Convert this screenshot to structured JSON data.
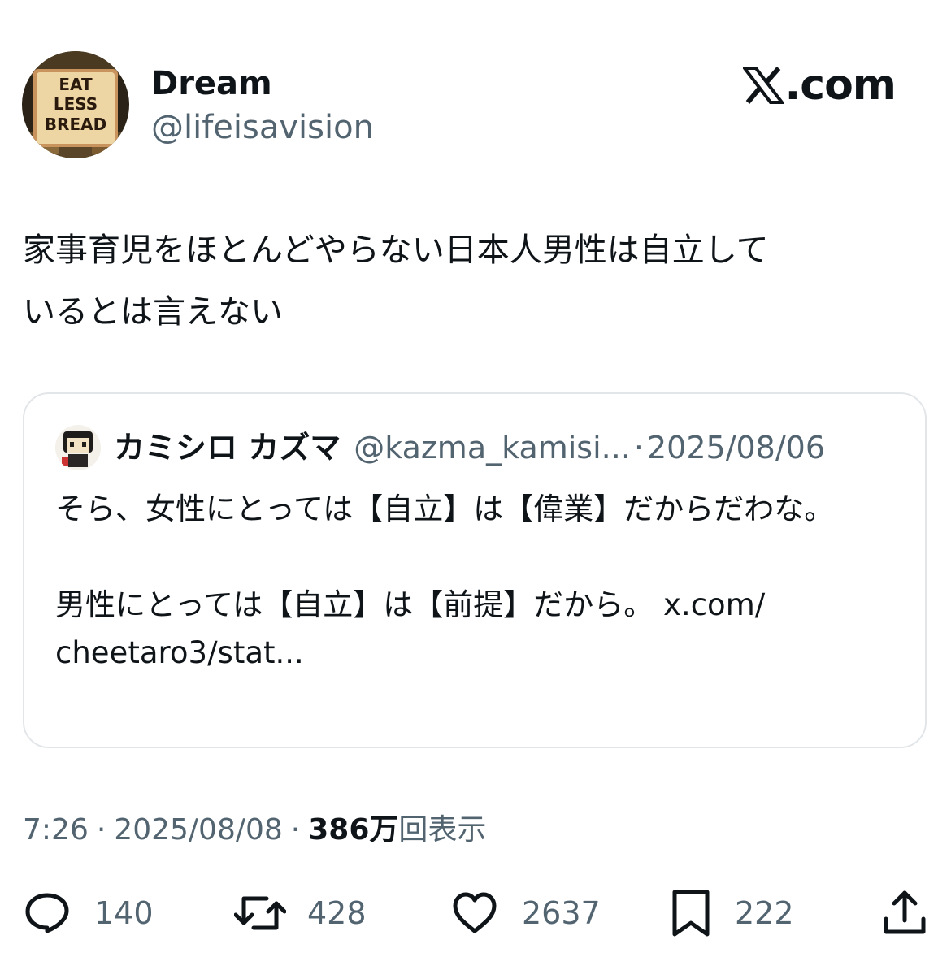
{
  "post": {
    "author": {
      "display_name": "Dream",
      "handle": "@lifeisavision",
      "avatar_text": "EAT LESS BREAD"
    },
    "brand": {
      "icon": "x-logo-icon",
      "text": ".com"
    },
    "text": "家事育児をほとんどやらない日本人男性は自立して\nいるとは言えない",
    "timestamp": "7:26",
    "separator": "·",
    "date": "2025/08/08",
    "views": {
      "count": "386万",
      "label": "回表示"
    }
  },
  "quote": {
    "display_name": "カミシロ カズマ",
    "handle": "@kazma_kamisi...",
    "separator": "·",
    "date": "2025/08/06",
    "text": "そら、女性にとっては【自立】は【偉業】だからだわな。\n\n男性にとっては【自立】は【前提】だから。 x.com/\ncheetaro3/stat..."
  },
  "actions": {
    "reply": {
      "icon": "reply-bubble-icon",
      "count": "140"
    },
    "repost": {
      "icon": "repost-icon",
      "count": "428"
    },
    "like": {
      "icon": "heart-icon",
      "count": "2637"
    },
    "bookmark": {
      "icon": "bookmark-icon",
      "count": "222"
    },
    "share": {
      "icon": "share-icon"
    }
  },
  "colors": {
    "text_primary": "#0f1419",
    "text_secondary": "#536471",
    "card_border": "#e3e6e9",
    "background": "#ffffff"
  }
}
